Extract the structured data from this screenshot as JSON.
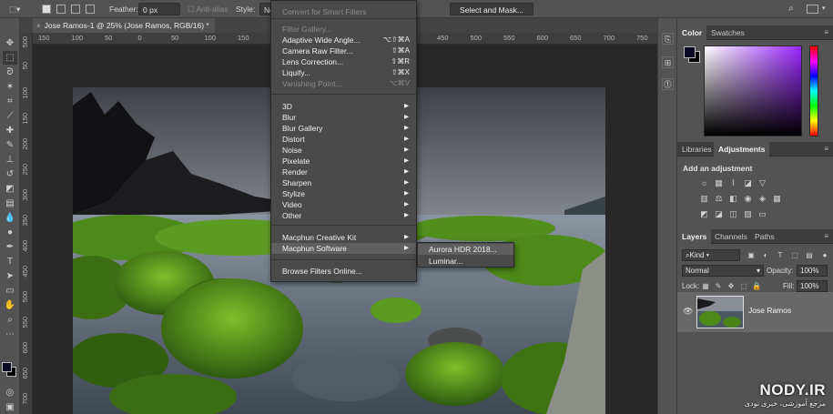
{
  "options_bar": {
    "feather_label": "Feather:",
    "feather_value": "0 px",
    "antialias_label": "Anti-alias",
    "style_label": "Style:",
    "style_value": "No",
    "select_mask_label": "Select and Mask..."
  },
  "document": {
    "tab_title": "Jose Ramos-1 @ 25% (Jose Ramos, RGB/16) *",
    "close_glyph": "×",
    "ruler_top": [
      "150",
      "100",
      "50",
      "0",
      "50",
      "100",
      "150",
      "200",
      "250",
      "300",
      "350",
      "400",
      "450",
      "500",
      "550",
      "600",
      "650",
      "700",
      "750"
    ],
    "ruler_left": [
      "500",
      "50",
      "100",
      "150",
      "200",
      "250",
      "300",
      "350",
      "400",
      "450",
      "500",
      "550",
      "600",
      "650",
      "700"
    ]
  },
  "filter_menu": {
    "items": [
      {
        "label": "Convert for Smart Filters",
        "shortcut": "",
        "disabled": true,
        "submenu": false
      },
      {
        "label": "Filter Gallery...",
        "shortcut": "",
        "disabled": true,
        "submenu": false
      },
      {
        "label": "Adaptive Wide Angle...",
        "shortcut": "⌥⇧⌘A",
        "disabled": false,
        "submenu": false
      },
      {
        "label": "Camera Raw Filter...",
        "shortcut": "⇧⌘A",
        "disabled": false,
        "submenu": false
      },
      {
        "label": "Lens Correction...",
        "shortcut": "⇧⌘R",
        "disabled": false,
        "submenu": false
      },
      {
        "label": "Liquify...",
        "shortcut": "⇧⌘X",
        "disabled": false,
        "submenu": false
      },
      {
        "label": "Vanishing Point...",
        "shortcut": "⌥⌘V",
        "disabled": true,
        "submenu": false
      },
      {
        "label": "3D",
        "shortcut": "",
        "disabled": false,
        "submenu": true
      },
      {
        "label": "Blur",
        "shortcut": "",
        "disabled": false,
        "submenu": true
      },
      {
        "label": "Blur Gallery",
        "shortcut": "",
        "disabled": false,
        "submenu": true
      },
      {
        "label": "Distort",
        "shortcut": "",
        "disabled": false,
        "submenu": true
      },
      {
        "label": "Noise",
        "shortcut": "",
        "disabled": false,
        "submenu": true
      },
      {
        "label": "Pixelate",
        "shortcut": "",
        "disabled": false,
        "submenu": true
      },
      {
        "label": "Render",
        "shortcut": "",
        "disabled": false,
        "submenu": true
      },
      {
        "label": "Sharpen",
        "shortcut": "",
        "disabled": false,
        "submenu": true
      },
      {
        "label": "Stylize",
        "shortcut": "",
        "disabled": false,
        "submenu": true
      },
      {
        "label": "Video",
        "shortcut": "",
        "disabled": false,
        "submenu": true
      },
      {
        "label": "Other",
        "shortcut": "",
        "disabled": false,
        "submenu": true
      },
      {
        "label": "Macphun Creative Kit",
        "shortcut": "",
        "disabled": false,
        "submenu": true
      },
      {
        "label": "Macphun Software",
        "shortcut": "",
        "disabled": false,
        "submenu": true,
        "highlighted": true
      },
      {
        "label": "Browse Filters Online...",
        "shortcut": "",
        "disabled": false,
        "submenu": false
      }
    ],
    "submenu_items": [
      "Aurora HDR 2018...",
      "Luminar..."
    ],
    "arrow_glyph": "▶"
  },
  "panels": {
    "color_tabs": [
      "Color",
      "Swatches"
    ],
    "adjust_tabs": [
      "Libraries",
      "Adjustments"
    ],
    "add_adjustment_label": "Add an adjustment",
    "layers_tabs": [
      "Layers",
      "Channels",
      "Paths"
    ],
    "kind_filter": "Kind",
    "blend_mode": "Normal",
    "opacity_label": "Opacity:",
    "opacity_value": "100%",
    "lock_label": "Lock:",
    "fill_label": "Fill:",
    "fill_value": "100%",
    "layer_name": "Jose Ramos",
    "panel_menu_glyph": "≡"
  },
  "watermark": {
    "main": "NODY.IR",
    "sub": "مرجع آموزشی، خبری نودی"
  }
}
